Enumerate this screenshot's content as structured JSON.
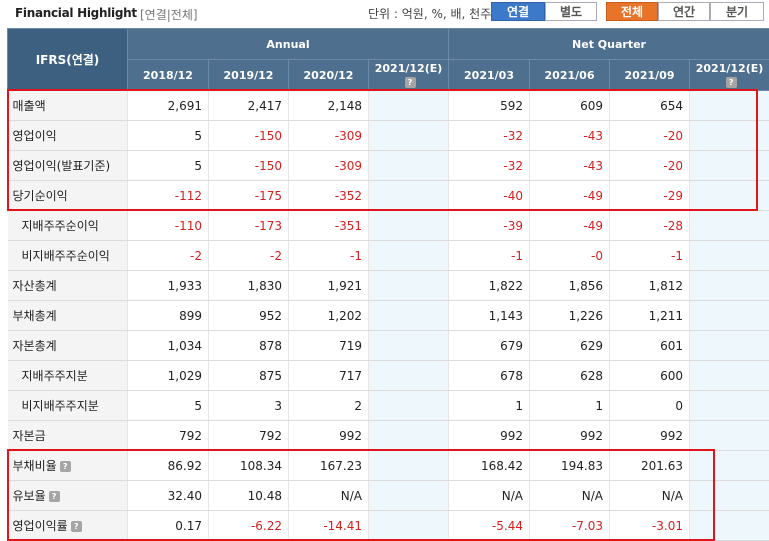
{
  "header": {
    "title": "Financial Highlight",
    "subtitle": "[연결|전체]",
    "unit": "단위 : 억원, %, 배, 천주",
    "buttons": {
      "consolidated": "연결",
      "separate": "별도",
      "all": "전체",
      "annual": "연간",
      "quarter": "분기"
    }
  },
  "table": {
    "ifrs_label": "IFRS(연결)",
    "group_annual": "Annual",
    "group_quarter": "Net Quarter",
    "columns": [
      "2018/12",
      "2019/12",
      "2020/12",
      "2021/12(E)",
      "2021/03",
      "2021/06",
      "2021/09",
      "2021/12(E)"
    ],
    "rows": [
      {
        "label": "매출액",
        "values": [
          "2,691",
          "2,417",
          "2,148",
          "",
          "592",
          "609",
          "654",
          ""
        ]
      },
      {
        "label": "영업이익",
        "values": [
          "5",
          "-150",
          "-309",
          "",
          "-32",
          "-43",
          "-20",
          ""
        ]
      },
      {
        "label": "영업이익(발표기준)",
        "values": [
          "5",
          "-150",
          "-309",
          "",
          "-32",
          "-43",
          "-20",
          ""
        ]
      },
      {
        "label": "당기순이익",
        "values": [
          "-112",
          "-175",
          "-352",
          "",
          "-40",
          "-49",
          "-29",
          ""
        ]
      },
      {
        "label": "지배주주순이익",
        "values": [
          "-110",
          "-173",
          "-351",
          "",
          "-39",
          "-49",
          "-28",
          ""
        ]
      },
      {
        "label": "비지배주주순이익",
        "values": [
          "-2",
          "-2",
          "-1",
          "",
          "-1",
          "-0",
          "-1",
          ""
        ]
      },
      {
        "label": "자산총계",
        "values": [
          "1,933",
          "1,830",
          "1,921",
          "",
          "1,822",
          "1,856",
          "1,812",
          ""
        ]
      },
      {
        "label": "부채총계",
        "values": [
          "899",
          "952",
          "1,202",
          "",
          "1,143",
          "1,226",
          "1,211",
          ""
        ]
      },
      {
        "label": "자본총계",
        "values": [
          "1,034",
          "878",
          "719",
          "",
          "679",
          "629",
          "601",
          ""
        ]
      },
      {
        "label": "지배주주지분",
        "values": [
          "1,029",
          "875",
          "717",
          "",
          "678",
          "628",
          "600",
          ""
        ]
      },
      {
        "label": "비지배주주지분",
        "values": [
          "5",
          "3",
          "2",
          "",
          "1",
          "1",
          "0",
          ""
        ]
      },
      {
        "label": "자본금",
        "values": [
          "792",
          "792",
          "992",
          "",
          "992",
          "992",
          "992",
          ""
        ]
      },
      {
        "label": "부채비율",
        "values": [
          "86.92",
          "108.34",
          "167.23",
          "",
          "168.42",
          "194.83",
          "201.63",
          ""
        ]
      },
      {
        "label": "유보율",
        "values": [
          "32.40",
          "10.48",
          "N/A",
          "",
          "N/A",
          "N/A",
          "N/A",
          ""
        ]
      },
      {
        "label": "영업이익률",
        "values": [
          "0.17",
          "-6.22",
          "-14.41",
          "",
          "-5.44",
          "-7.03",
          "-3.01",
          ""
        ]
      }
    ]
  },
  "help_glyph": "?",
  "colors": {
    "header_bg": "#4f6f8f",
    "negative": "#d62020",
    "highlight_border": "#e1141b",
    "estimate_bg": "#eef7fb"
  }
}
